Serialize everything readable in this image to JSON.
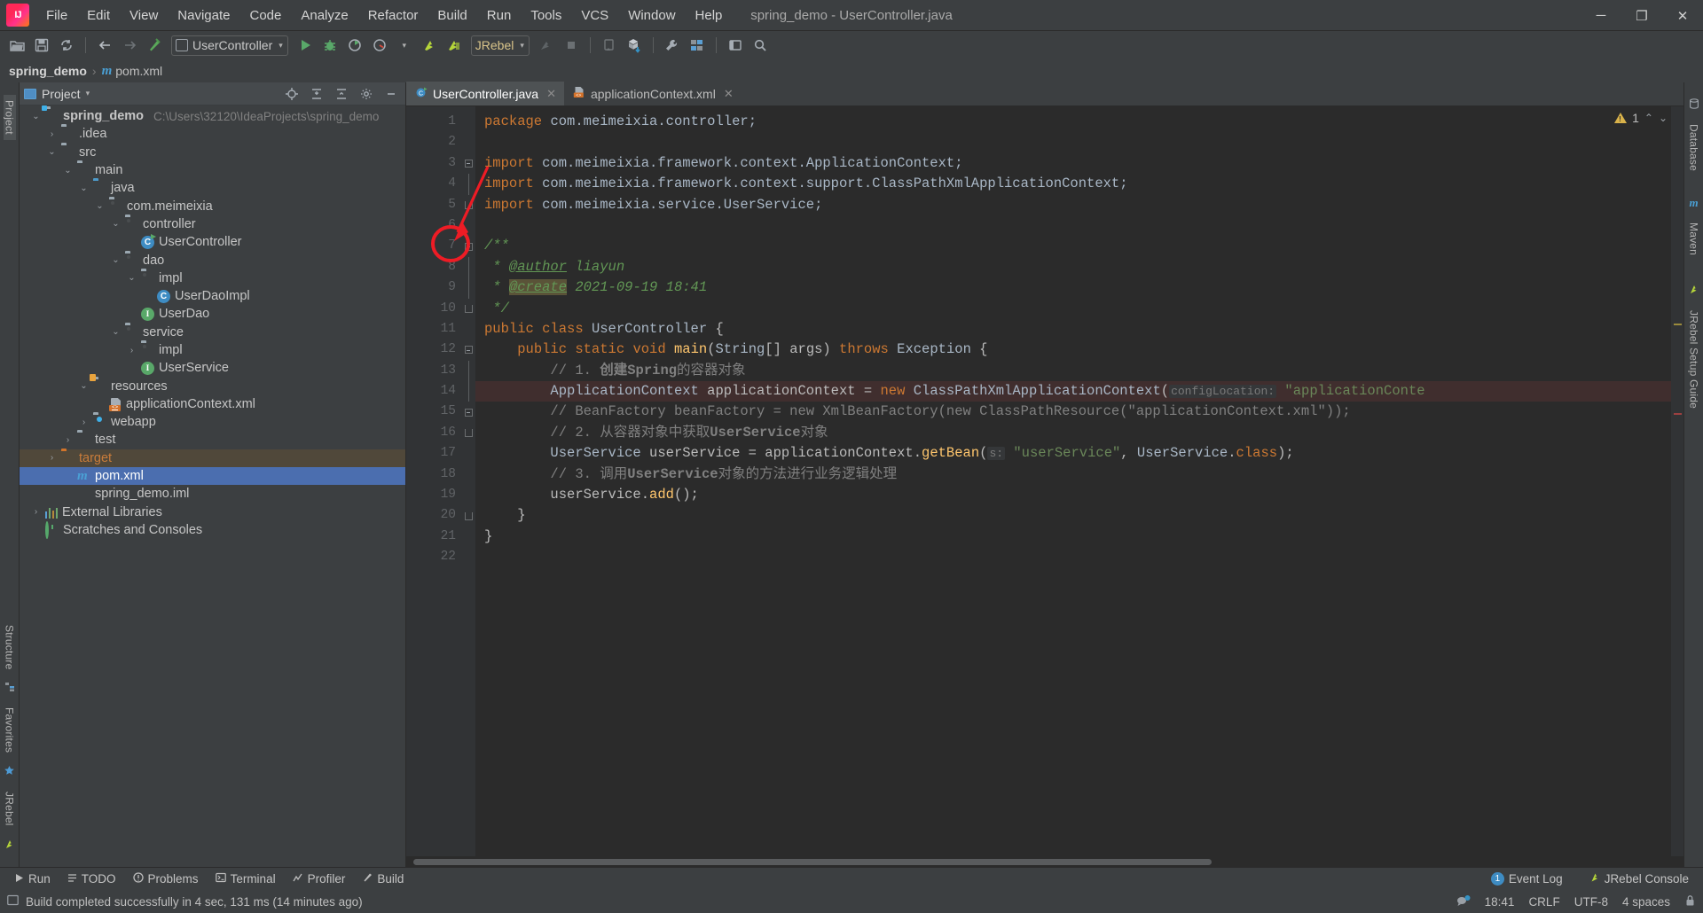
{
  "window": {
    "title": "spring_demo - UserController.java",
    "logo": "intellij-idea-logo",
    "controls": {
      "minimize": "─",
      "maximize": "❐",
      "close": "✕"
    }
  },
  "menubar": {
    "items": [
      {
        "label": "File"
      },
      {
        "label": "Edit"
      },
      {
        "label": "View"
      },
      {
        "label": "Navigate"
      },
      {
        "label": "Code"
      },
      {
        "label": "Analyze"
      },
      {
        "label": "Refactor"
      },
      {
        "label": "Build"
      },
      {
        "label": "Run"
      },
      {
        "label": "Tools"
      },
      {
        "label": "VCS"
      },
      {
        "label": "Window"
      },
      {
        "label": "Help"
      }
    ]
  },
  "toolbar": {
    "open_icon": "open-folder-icon",
    "save_icon": "save-icon",
    "sync_icon": "sync-icon",
    "back_icon": "back-arrow-icon",
    "forward_icon": "forward-arrow-icon",
    "build_icon": "build-hammer-icon",
    "run_config": "UserController",
    "run_icon": "run-icon",
    "debug_icon": "debug-icon",
    "run_coverage_icon": "run-with-coverage-icon",
    "profile_icon": "profiler-icon",
    "jrebel_run_icon": "jrebel-run-icon",
    "jrebel_debug_icon": "jrebel-debug-icon",
    "jrebel_label": "JRebel",
    "stop_icon": "stop-icon",
    "square_icon": "stop-square-icon",
    "device_icon": "device-manager-icon",
    "sdk_icon": "sdk-download-icon",
    "wrench_icon": "settings-wrench-icon",
    "struct_icon": "project-structure-icon",
    "search_icon": "search-everywhere-icon",
    "caret": "▾"
  },
  "breadcrumb": {
    "project": "spring_demo",
    "separator": "›",
    "file": "pom.xml",
    "file_icon": "maven-m-icon"
  },
  "left_strip": {
    "project_label": "Project",
    "structure_label": "Structure",
    "favorites_label": "Favorites",
    "jrebel_label": "JRebel"
  },
  "right_strip": {
    "database_label": "Database",
    "maven_label": "Maven",
    "jrebel_setup_label": "JRebel Setup Guide"
  },
  "project_panel": {
    "title": "Project",
    "title_caret": "▾",
    "icons": {
      "locate": "locate-target-icon",
      "expand": "expand-all-icon",
      "collapse": "collapse-all-icon",
      "settings": "gear-icon",
      "hide": "hide-panel-icon"
    },
    "tree": [
      {
        "label": "spring_demo",
        "sub": "C:\\Users\\32120\\IdeaProjects\\spring_demo",
        "indent": 0,
        "arrow": "down",
        "icon": "module-folder",
        "bold": true,
        "state": "normal"
      },
      {
        "label": ".idea",
        "sub": "",
        "indent": 1,
        "arrow": "right",
        "icon": "folder-gray",
        "bold": false,
        "state": "normal"
      },
      {
        "label": "src",
        "sub": "",
        "indent": 1,
        "arrow": "down",
        "icon": "folder-gray",
        "bold": false,
        "state": "normal"
      },
      {
        "label": "main",
        "sub": "",
        "indent": 2,
        "arrow": "down",
        "icon": "folder-gray",
        "bold": false,
        "state": "normal"
      },
      {
        "label": "java",
        "sub": "",
        "indent": 3,
        "arrow": "down",
        "icon": "folder-blue-source",
        "bold": false,
        "state": "normal"
      },
      {
        "label": "com.meimeixia",
        "sub": "",
        "indent": 4,
        "arrow": "down",
        "icon": "package",
        "bold": false,
        "state": "normal"
      },
      {
        "label": "controller",
        "sub": "",
        "indent": 5,
        "arrow": "down",
        "icon": "package",
        "bold": false,
        "state": "normal"
      },
      {
        "label": "UserController",
        "sub": "",
        "indent": 6,
        "arrow": "none",
        "icon": "class-runnable",
        "bold": false,
        "state": "normal"
      },
      {
        "label": "dao",
        "sub": "",
        "indent": 5,
        "arrow": "down",
        "icon": "package",
        "bold": false,
        "state": "normal"
      },
      {
        "label": "impl",
        "sub": "",
        "indent": 6,
        "arrow": "down",
        "icon": "package",
        "bold": false,
        "state": "normal"
      },
      {
        "label": "UserDaoImpl",
        "sub": "",
        "indent": 7,
        "arrow": "none",
        "icon": "class",
        "bold": false,
        "state": "normal"
      },
      {
        "label": "UserDao",
        "sub": "",
        "indent": 6,
        "arrow": "none",
        "icon": "interface",
        "bold": false,
        "state": "normal"
      },
      {
        "label": "service",
        "sub": "",
        "indent": 5,
        "arrow": "down",
        "icon": "package",
        "bold": false,
        "state": "normal"
      },
      {
        "label": "impl",
        "sub": "",
        "indent": 6,
        "arrow": "right",
        "icon": "package",
        "bold": false,
        "state": "normal"
      },
      {
        "label": "UserService",
        "sub": "",
        "indent": 6,
        "arrow": "none",
        "icon": "interface",
        "bold": false,
        "state": "normal"
      },
      {
        "label": "resources",
        "sub": "",
        "indent": 3,
        "arrow": "down",
        "icon": "folder-resources",
        "bold": false,
        "state": "normal"
      },
      {
        "label": "applicationContext.xml",
        "sub": "",
        "indent": 4,
        "arrow": "none",
        "icon": "xml-file",
        "bold": false,
        "state": "normal"
      },
      {
        "label": "webapp",
        "sub": "",
        "indent": 3,
        "arrow": "right",
        "icon": "folder-webapp",
        "bold": false,
        "state": "normal"
      },
      {
        "label": "test",
        "sub": "",
        "indent": 2,
        "arrow": "right",
        "icon": "folder-gray",
        "bold": false,
        "state": "normal"
      },
      {
        "label": "target",
        "sub": "",
        "indent": 1,
        "arrow": "right",
        "icon": "folder-orange",
        "bold": false,
        "state": "excluded"
      },
      {
        "label": "pom.xml",
        "sub": "",
        "indent": 2,
        "arrow": "none",
        "icon": "maven-m",
        "bold": false,
        "state": "selected"
      },
      {
        "label": "spring_demo.iml",
        "sub": "",
        "indent": 2,
        "arrow": "none",
        "icon": "iml-file",
        "bold": false,
        "state": "normal"
      },
      {
        "label": "External Libraries",
        "sub": "",
        "indent": 0,
        "arrow": "right",
        "icon": "libraries",
        "bold": false,
        "state": "normal"
      },
      {
        "label": "Scratches and Consoles",
        "sub": "",
        "indent": 0,
        "arrow": "none",
        "icon": "scratches",
        "bold": false,
        "state": "normal"
      }
    ]
  },
  "editor": {
    "tabs": [
      {
        "label": "UserController.java",
        "icon": "java-class-runnable-icon",
        "active": true,
        "close": "✕"
      },
      {
        "label": "applicationContext.xml",
        "icon": "xml-file-icon",
        "active": false,
        "close": "✕"
      }
    ],
    "inspection": {
      "count": "1",
      "icon": "warning-triangle-icon",
      "up": "⌃",
      "down": "⌄"
    },
    "line_numbers": [
      "1",
      "2",
      "3",
      "4",
      "5",
      "6",
      "7",
      "8",
      "9",
      "10",
      "11",
      "12",
      "13",
      "14",
      "15",
      "16",
      "17",
      "18",
      "19",
      "20",
      "21",
      "22"
    ],
    "gutter_markers": {
      "run_class_line": "11",
      "run_method_line": "12",
      "breakpoint_line": "14",
      "bulb_line": "18"
    },
    "code_lines": [
      {
        "n": 1,
        "text": "package com.meimeixia.controller;"
      },
      {
        "n": 2,
        "text": ""
      },
      {
        "n": 3,
        "text": "import com.meimeixia.framework.context.ApplicationContext;"
      },
      {
        "n": 4,
        "text": "import com.meimeixia.framework.context.support.ClassPathXmlApplicationContext;"
      },
      {
        "n": 5,
        "text": "import com.meimeixia.service.UserService;"
      },
      {
        "n": 6,
        "text": ""
      },
      {
        "n": 7,
        "text": "/**"
      },
      {
        "n": 8,
        "text": " * @author liayun"
      },
      {
        "n": 9,
        "text": " * @create 2021-09-19 18:41"
      },
      {
        "n": 10,
        "text": " */"
      },
      {
        "n": 11,
        "text": "public class UserController {"
      },
      {
        "n": 12,
        "text": "    public static void main(String[] args) throws Exception {"
      },
      {
        "n": 13,
        "text": "        // 1. 创建Spring的容器对象"
      },
      {
        "n": 14,
        "text": "        ApplicationContext applicationContext = new ClassPathXmlApplicationContext( configLocation: \"applicationConte"
      },
      {
        "n": 15,
        "text": "        // BeanFactory beanFactory = new XmlBeanFactory(new ClassPathResource(\"applicationContext.xml\"));"
      },
      {
        "n": 16,
        "text": "        // 2. 从容器对象中获取UserService对象"
      },
      {
        "n": 17,
        "text": "        UserService userService = applicationContext.getBean( s: \"userService\", UserService.class);"
      },
      {
        "n": 18,
        "text": "        // 3. 调用UserService对象的方法进行业务逻辑处理"
      },
      {
        "n": 19,
        "text": "        userService.add();"
      },
      {
        "n": 20,
        "text": "    }"
      },
      {
        "n": 21,
        "text": "}"
      },
      {
        "n": 22,
        "text": ""
      }
    ],
    "javadoc": {
      "author_tag": "@author",
      "author_value": "liayun",
      "create_tag": "@create",
      "create_value": "2021-09-19 18:41"
    },
    "param_hints": {
      "config_location": "configLocation:",
      "bean_name": "s:"
    },
    "annotation": {
      "type": "red-circle-with-arrow",
      "color": "#ee1c25",
      "target_line": "14"
    }
  },
  "tool_windows": {
    "left": [
      {
        "label": "Run",
        "icon": "run-icon"
      },
      {
        "label": "TODO",
        "icon": "todo-icon"
      },
      {
        "label": "Problems",
        "icon": "problems-icon"
      },
      {
        "label": "Terminal",
        "icon": "terminal-icon"
      },
      {
        "label": "Profiler",
        "icon": "profiler-icon"
      },
      {
        "label": "Build",
        "icon": "build-icon"
      }
    ],
    "right": [
      {
        "label": "Event Log",
        "count": "1",
        "icon": "event-log-icon"
      },
      {
        "label": "JRebel Console",
        "icon": "jrebel-console-icon"
      }
    ]
  },
  "status_bar": {
    "message": "Build completed successfully in 4 sec, 131 ms (14 minutes ago)",
    "message_icon": "build-status-icon",
    "time": "18:41",
    "line_separator": "CRLF",
    "encoding": "UTF-8",
    "indent": "4 spaces",
    "notifications_icon": "notifications-bell-icon",
    "lock_icon": "read-only-lock-icon"
  },
  "colors": {
    "accent_blue": "#4b6eaf",
    "selection": "#4b6eaf",
    "excluded_orange": "#c97c3a",
    "keyword": "#cc7832",
    "string": "#6a8759",
    "comment": "#808080",
    "javadoc": "#629755",
    "number": "#6897bb",
    "identifier": "#a9b7c6",
    "method": "#ffc66d",
    "annotation_red": "#ee1c25",
    "breakpoint_line_bg": "#402e2e"
  }
}
